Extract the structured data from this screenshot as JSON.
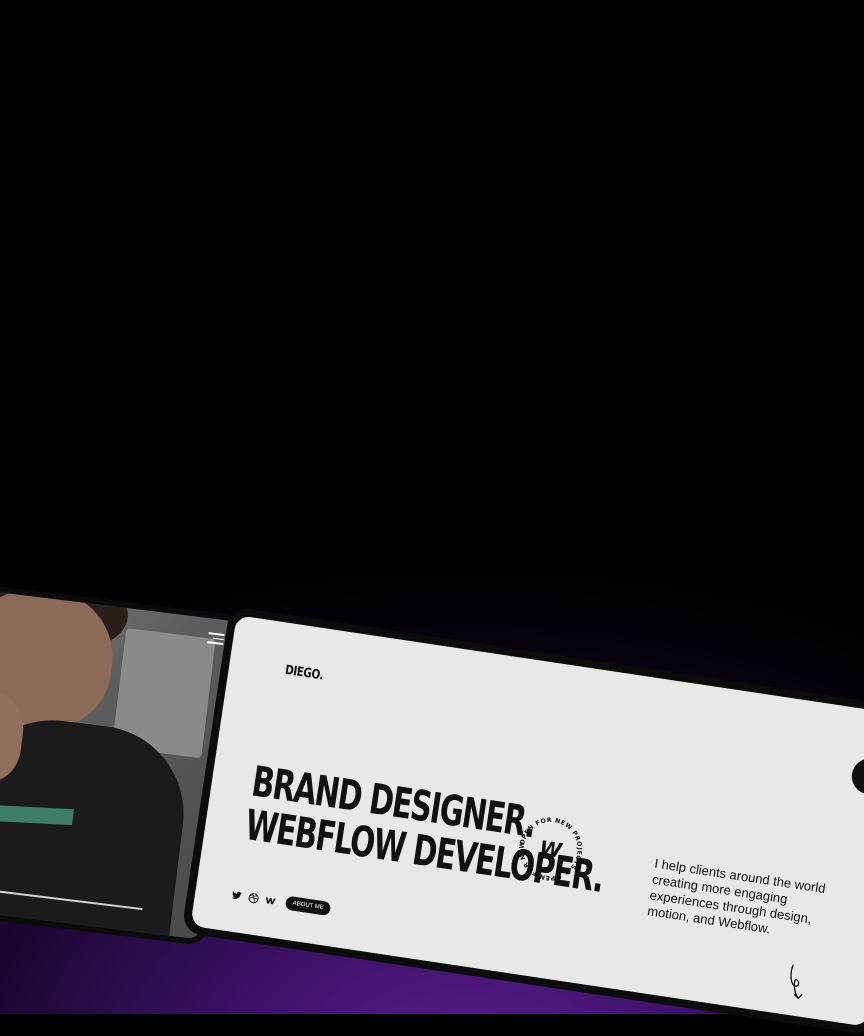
{
  "hero": {
    "logo": "DIEGO.",
    "headline_line1": "BRAND DESIGNER.",
    "headline_line2": "WEBFLOW DEVELOPER.",
    "badge_text": "OPEN FOR NEW PROJECTS ★ OPEN FOR NEW PROJECTS ★",
    "badge_letter": "W",
    "about_button": "ABOUT ME",
    "intro": "I help clients around the world creating more engaging experiences through design, motion, and Webflow."
  },
  "socials": [
    {
      "icon": "twitter-icon"
    },
    {
      "icon": "dribbble-icon"
    },
    {
      "icon": "webflow-icon"
    }
  ],
  "colors": {
    "card_background": "#e8e8e8",
    "text": "#111111",
    "glow": "#5a1f8f"
  }
}
